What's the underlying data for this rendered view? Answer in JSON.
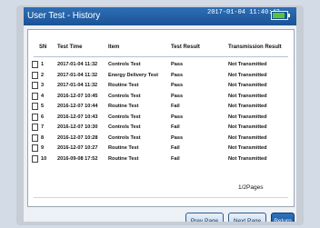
{
  "window": {
    "title": "User Test - History",
    "datetime": "2017-01-04 11:40:42",
    "battery_level": 0.85,
    "battery_icon": "battery-icon"
  },
  "table": {
    "headers": [
      "SN",
      "Test Time",
      "Item",
      "Test Result",
      "Transmission Result"
    ],
    "rows": [
      {
        "sn": "1",
        "time": "2017-01-04 11:32",
        "item": "Controls Test",
        "result": "Pass",
        "transmission": "Not Transmitted"
      },
      {
        "sn": "2",
        "time": "2017-01-04 11:32",
        "item": "Energy Delivery Test",
        "result": "Pass",
        "transmission": "Not Transmitted"
      },
      {
        "sn": "3",
        "time": "2017-01-04 11:32",
        "item": "Routine Test",
        "result": "Pass",
        "transmission": "Not Transmitted"
      },
      {
        "sn": "4",
        "time": "2016-12-07 10:45",
        "item": "Controls Test",
        "result": "Pass",
        "transmission": "Not Transmitted"
      },
      {
        "sn": "5",
        "time": "2016-12-07 10:44",
        "item": "Routine Test",
        "result": "Fail",
        "transmission": "Not Transmitted"
      },
      {
        "sn": "6",
        "time": "2016-12-07 10:43",
        "item": "Controls Test",
        "result": "Pass",
        "transmission": "Not Transmitted"
      },
      {
        "sn": "7",
        "time": "2016-12-07 10:30",
        "item": "Controls Test",
        "result": "Fail",
        "transmission": "Not Transmitted"
      },
      {
        "sn": "8",
        "time": "2016-12-07 10:28",
        "item": "Controls Test",
        "result": "Pass",
        "transmission": "Not Transmitted"
      },
      {
        "sn": "9",
        "time": "2016-12-07 10:27",
        "item": "Routine Test",
        "result": "Fail",
        "transmission": "Not Transmitted"
      },
      {
        "sn": "10",
        "time": "2016-09-08 17:52",
        "item": "Routine Test",
        "result": "Fail",
        "transmission": "Not Transmitted"
      }
    ]
  },
  "pagination": {
    "label": "1/2Pages"
  },
  "buttons": {
    "prev": "Prev Page",
    "next": "Next Page",
    "return": "Return"
  },
  "colors": {
    "titlebar": "#1c5296",
    "battery": "#57c53c",
    "accent_button": "#164f95"
  }
}
